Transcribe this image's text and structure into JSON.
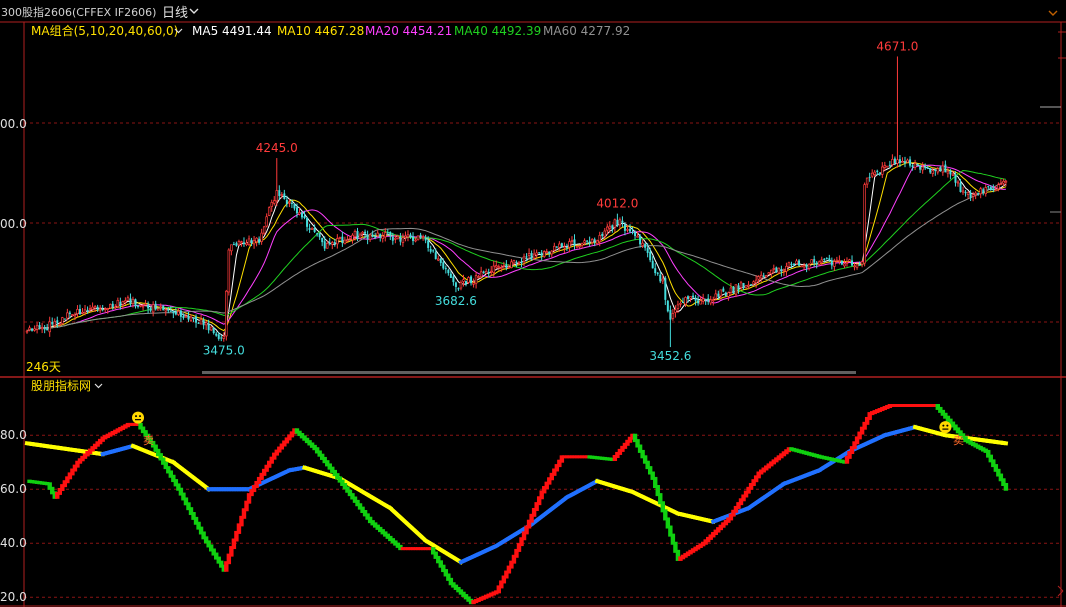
{
  "header": {
    "contract": "300股指2606(CFFEX IF2606)",
    "period": "日线",
    "ma_group_label": "MA组合(5,10,20,40,60,0)",
    "ma_items": [
      {
        "text": "MA5 4491.44",
        "color": "#ffffff"
      },
      {
        "text": "MA10 4467.28",
        "color": "#ffe000"
      },
      {
        "text": "MA20 4454.21",
        "color": "#ff40ff"
      },
      {
        "text": "MA40 4492.39",
        "color": "#20d020"
      },
      {
        "text": "MA60 4277.92",
        "color": "#909090"
      }
    ]
  },
  "indicator_panel": {
    "label": "股朋指标网",
    "marker_text": "卖"
  },
  "colors": {
    "up_candle": "#ff3b3b",
    "down_candle": "#44dddd",
    "grid": "#8a1414",
    "frame": "#b02020",
    "scroll": "#606060",
    "ind_red": "#ff1010",
    "ind_green": "#10d010",
    "ind_yellow": "#ffff00",
    "ind_blue": "#2070ff",
    "face": "#ffd800"
  },
  "chart_data": [
    {
      "type": "candlestick",
      "description_labels": {
        "y_ticks_partial": [
          "00.0",
          "00.0"
        ],
        "bars_label": "246天"
      },
      "ylim": [
        3390,
        4740
      ],
      "annotations": [
        {
          "text": "4245.0",
          "bar": 99,
          "value": 4245.0,
          "kind": "high"
        },
        {
          "text": "4012.0",
          "bar": 234,
          "value": 4012.0,
          "kind": "high"
        },
        {
          "text": "4671.0",
          "bar": 345,
          "value": 4671.0,
          "kind": "high"
        },
        {
          "text": "3475.0",
          "bar": 78,
          "value": 3475.0,
          "kind": "low"
        },
        {
          "text": "3682.6",
          "bar": 170,
          "value": 3682.6,
          "kind": "low"
        },
        {
          "text": "3452.6",
          "bar": 255,
          "value": 3452.6,
          "kind": "low"
        }
      ],
      "price_path": [
        [
          0,
          3520
        ],
        [
          8,
          3540
        ],
        [
          22,
          3610
        ],
        [
          40,
          3645
        ],
        [
          55,
          3600
        ],
        [
          68,
          3560
        ],
        [
          78,
          3490
        ],
        [
          80,
          3870
        ],
        [
          92,
          3900
        ],
        [
          99,
          4110
        ],
        [
          108,
          4010
        ],
        [
          118,
          3880
        ],
        [
          130,
          3920
        ],
        [
          140,
          3920
        ],
        [
          158,
          3900
        ],
        [
          170,
          3705
        ],
        [
          178,
          3740
        ],
        [
          185,
          3780
        ],
        [
          200,
          3830
        ],
        [
          215,
          3880
        ],
        [
          226,
          3900
        ],
        [
          234,
          3980
        ],
        [
          244,
          3880
        ],
        [
          252,
          3720
        ],
        [
          255,
          3560
        ],
        [
          258,
          3640
        ],
        [
          270,
          3660
        ],
        [
          282,
          3700
        ],
        [
          293,
          3770
        ],
        [
          305,
          3800
        ],
        [
          318,
          3805
        ],
        [
          331,
          3800
        ],
        [
          332,
          4150
        ],
        [
          345,
          4240
        ],
        [
          355,
          4200
        ],
        [
          365,
          4200
        ],
        [
          372,
          4080
        ],
        [
          380,
          4120
        ],
        [
          388,
          4140
        ]
      ],
      "series": [
        {
          "name": "MA5",
          "period": 5,
          "color": "#ffffff"
        },
        {
          "name": "MA10",
          "period": 10,
          "color": "#ffe000"
        },
        {
          "name": "MA20",
          "period": 20,
          "color": "#ff40ff"
        },
        {
          "name": "MA40",
          "period": 40,
          "color": "#20d020"
        },
        {
          "name": "MA60",
          "period": 60,
          "color": "#909090"
        }
      ]
    },
    {
      "type": "line",
      "y_ticks": [
        "80.0",
        "60.0",
        "40.0",
        "20.0"
      ],
      "ylim": [
        17.5,
        96
      ],
      "fast_line_path": [
        [
          0,
          63
        ],
        [
          8,
          62
        ],
        [
          11,
          57
        ],
        [
          20,
          70
        ],
        [
          30,
          79
        ],
        [
          40,
          84
        ],
        [
          44,
          84
        ],
        [
          50,
          76
        ],
        [
          60,
          60
        ],
        [
          70,
          42
        ],
        [
          78,
          30
        ],
        [
          88,
          58
        ],
        [
          98,
          73
        ],
        [
          106,
          82
        ],
        [
          114,
          75
        ],
        [
          124,
          63
        ],
        [
          136,
          48
        ],
        [
          148,
          38
        ],
        [
          160,
          38
        ],
        [
          168,
          25
        ],
        [
          176,
          18
        ],
        [
          186,
          22
        ],
        [
          192,
          33
        ],
        [
          204,
          59
        ],
        [
          212,
          72
        ],
        [
          222,
          72
        ],
        [
          232,
          71
        ],
        [
          240,
          80
        ],
        [
          248,
          64
        ],
        [
          258,
          34
        ],
        [
          268,
          40
        ],
        [
          278,
          49
        ],
        [
          290,
          66
        ],
        [
          302,
          75
        ],
        [
          314,
          72
        ],
        [
          324,
          70
        ],
        [
          334,
          88
        ],
        [
          342,
          91
        ],
        [
          350,
          91
        ],
        [
          360,
          91
        ],
        [
          372,
          78
        ],
        [
          380,
          74
        ],
        [
          388,
          60
        ]
      ],
      "slow_line_path": [
        [
          0,
          77
        ],
        [
          30,
          73
        ],
        [
          42,
          76
        ],
        [
          58,
          70
        ],
        [
          72,
          60
        ],
        [
          88,
          60
        ],
        [
          104,
          67
        ],
        [
          110,
          68
        ],
        [
          124,
          64
        ],
        [
          144,
          53
        ],
        [
          158,
          41
        ],
        [
          172,
          33
        ],
        [
          186,
          39
        ],
        [
          200,
          47
        ],
        [
          214,
          57
        ],
        [
          226,
          63
        ],
        [
          240,
          59
        ],
        [
          258,
          51
        ],
        [
          272,
          48
        ],
        [
          286,
          53
        ],
        [
          300,
          62
        ],
        [
          314,
          67
        ],
        [
          326,
          74
        ],
        [
          340,
          80
        ],
        [
          352,
          83
        ],
        [
          364,
          80
        ],
        [
          388,
          77
        ]
      ],
      "markers": [
        {
          "bar": 44,
          "value": 86.5,
          "kind": "face"
        },
        {
          "bar": 46,
          "value": 82,
          "kind": "sell_label"
        },
        {
          "bar": 364,
          "value": 83,
          "kind": "face"
        },
        {
          "bar": 367,
          "value": 82,
          "kind": "sell_label"
        }
      ]
    }
  ]
}
